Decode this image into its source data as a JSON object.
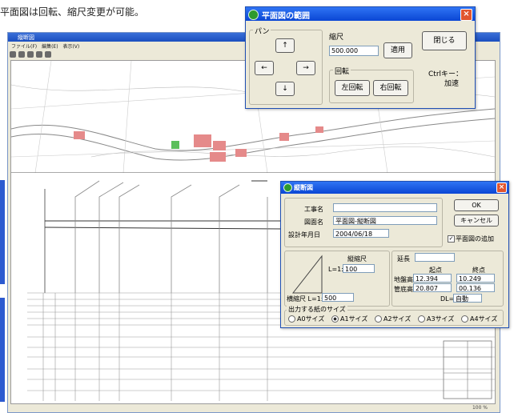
{
  "caption": "平面図は回転、縮尺変更が可能。",
  "main_window": {
    "title": "縦断図",
    "menu": [
      "ファイル(F)",
      "編集(E)",
      "表示(V)"
    ],
    "status": "100 %"
  },
  "plan_dialog": {
    "title": "平面図の範囲",
    "pan_label": "パン",
    "up": "↑",
    "left": "←",
    "right": "→",
    "down": "↓",
    "scale_label": "縮尺",
    "scale_value": "500.000",
    "apply": "適用",
    "close": "閉じる",
    "rotate_label": "回転",
    "rotate_left": "左回転",
    "rotate_right": "右回転",
    "ctrl_hint_1": "Ctrlキー：",
    "ctrl_hint_2": "加速"
  },
  "profile_dialog": {
    "title": "縦断図",
    "work_name_label": "工事名",
    "work_name_value": "",
    "drawing_name_label": "図面名",
    "drawing_name_value": "平面図-縦断図",
    "design_date_label": "設計年月日",
    "design_date_value": "2004/06/18",
    "ok": "OK",
    "cancel": "キャンセル",
    "add_plan_label": "平面図の追加",
    "add_plan_checked": true,
    "vertical_scale_label": "縦縮尺",
    "vertical_scale_prefix": "L=1:",
    "vertical_scale_value": "100",
    "horizontal_scale_label": "横縮尺 L=1:",
    "horizontal_scale_value": "500",
    "length_label": "延長",
    "length_value": "",
    "start_label": "起点",
    "end_label": "終点",
    "ground_label": "地盤高",
    "ground_start": "12.394",
    "ground_end": "10.249",
    "pipe_label": "管底高",
    "pipe_start": "20.807",
    "pipe_end": "00.136",
    "dl_label": "DL=",
    "dl_value": "自動",
    "paper_group_label": "出力する紙のサイズ",
    "paper_sizes": [
      "A0サイズ",
      "A1サイズ",
      "A2サイズ",
      "A3サイズ",
      "A4サイズ"
    ],
    "paper_selected": "A1サイズ"
  }
}
